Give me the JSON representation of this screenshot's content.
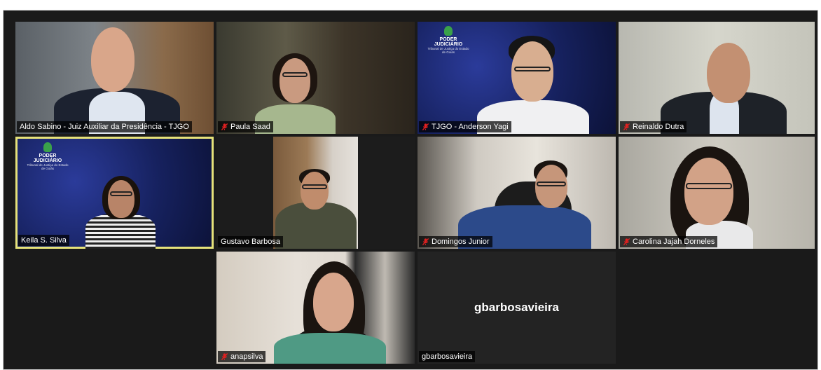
{
  "participants": [
    {
      "name": "Aldo Sabino - Juiz Auxiliar da Presidência - TJGO",
      "muted": false
    },
    {
      "name": "Paula Saad",
      "muted": true
    },
    {
      "name": "TJGO - Anderson Yagi",
      "muted": true
    },
    {
      "name": "Reinaldo Dutra",
      "muted": true
    },
    {
      "name": "Keila S. Silva",
      "muted": false,
      "active_speaker": true
    },
    {
      "name": "Gustavo Barbosa",
      "muted": false
    },
    {
      "name": "Domingos Junior",
      "muted": true
    },
    {
      "name": "Carolina Jajah Dorneles",
      "muted": true
    },
    {
      "name": "anapsilva",
      "muted": true
    },
    {
      "name": "gbarbosavieira",
      "muted": false,
      "video_off": true,
      "display_name": "gbarbosavieira"
    }
  ],
  "backgrounds": {
    "logo_title": "PODER JUDICIÁRIO",
    "logo_subtitle": "Tribunal de Justiça do Estado de Goiás"
  },
  "colors": {
    "active_speaker_border": "#e6e27a",
    "muted_icon": "#e02020",
    "tile_background": "#1a1a1a"
  }
}
